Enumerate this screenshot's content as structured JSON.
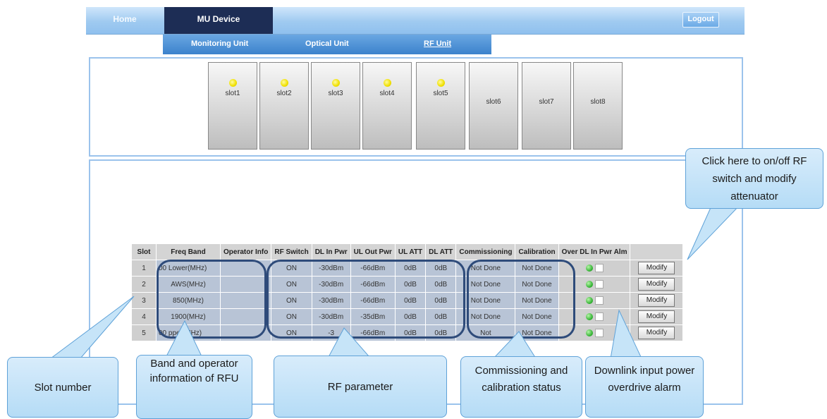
{
  "nav": {
    "home": "Home",
    "active_tab": "MU Device",
    "logout": "Logout"
  },
  "subnav": {
    "items": [
      "Monitoring Unit",
      "Optical Unit",
      "RF Unit"
    ],
    "active": "RF Unit"
  },
  "slots": [
    {
      "label": "slot1",
      "led": "yellow"
    },
    {
      "label": "slot2",
      "led": "yellow"
    },
    {
      "label": "slot3",
      "led": "yellow"
    },
    {
      "label": "slot4",
      "led": "yellow"
    },
    {
      "label": "slot5",
      "led": "yellow"
    },
    {
      "label": "slot6",
      "led": "none"
    },
    {
      "label": "slot7",
      "led": "none"
    },
    {
      "label": "slot8",
      "led": "none"
    }
  ],
  "table": {
    "headers": [
      "Slot",
      "Freq Band",
      "Operator Info",
      "RF Switch",
      "DL In Pwr",
      "UL Out Pwr",
      "UL ATT",
      "DL ATT",
      "Commissioning",
      "Calibration",
      "Over DL In Pwr Alm",
      ""
    ],
    "rows": [
      {
        "slot": "1",
        "band": "00 Lower(MHz)",
        "operator": "",
        "rf_switch": "ON",
        "dl_in": "-30dBm",
        "ul_out": "-66dBm",
        "ul_att": "0dB",
        "dl_att": "0dB",
        "commissioning": "Not Done",
        "calibration": "Not Done",
        "modify": "Modify"
      },
      {
        "slot": "2",
        "band": "AWS(MHz)",
        "operator": "",
        "rf_switch": "ON",
        "dl_in": "-30dBm",
        "ul_out": "-66dBm",
        "ul_att": "0dB",
        "dl_att": "0dB",
        "commissioning": "Not Done",
        "calibration": "Not Done",
        "modify": "Modify"
      },
      {
        "slot": "3",
        "band": "850(MHz)",
        "operator": "",
        "rf_switch": "ON",
        "dl_in": "-30dBm",
        "ul_out": "-66dBm",
        "ul_att": "0dB",
        "dl_att": "0dB",
        "commissioning": "Not Done",
        "calibration": "Not Done",
        "modify": "Modify"
      },
      {
        "slot": "4",
        "band": "1900(MHz)",
        "operator": "",
        "rf_switch": "ON",
        "dl_in": "-30dBm",
        "ul_out": "-35dBm",
        "ul_att": "0dB",
        "dl_att": "0dB",
        "commissioning": "Not Done",
        "calibration": "Not Done",
        "modify": "Modify"
      },
      {
        "slot": "5",
        "band": "00 pper(MHz)",
        "operator": "",
        "rf_switch": "ON",
        "dl_in": "-3",
        "ul_out": "-66dBm",
        "ul_att": "0dB",
        "dl_att": "0dB",
        "commissioning": "Not",
        "calibration": "Not Done",
        "modify": "Modify"
      }
    ]
  },
  "callouts": {
    "slot_number": "Slot number",
    "band_operator": "Band and operator information of RFU",
    "rf_parameter": "RF parameter",
    "commissioning": "Commissioning and calibration status",
    "downlink_alarm": "Downlink input power overdrive alarm",
    "rf_switch": "Click here to on/off RF switch and modify attenuator"
  },
  "colors": {
    "nav_dark": "#1d2d55",
    "nav_light": "#9fcaf0",
    "callout_fill": "#c6e4f8",
    "outline": "#2e4b7a",
    "led_yellow": "#f0e000",
    "led_green": "#33b233"
  }
}
